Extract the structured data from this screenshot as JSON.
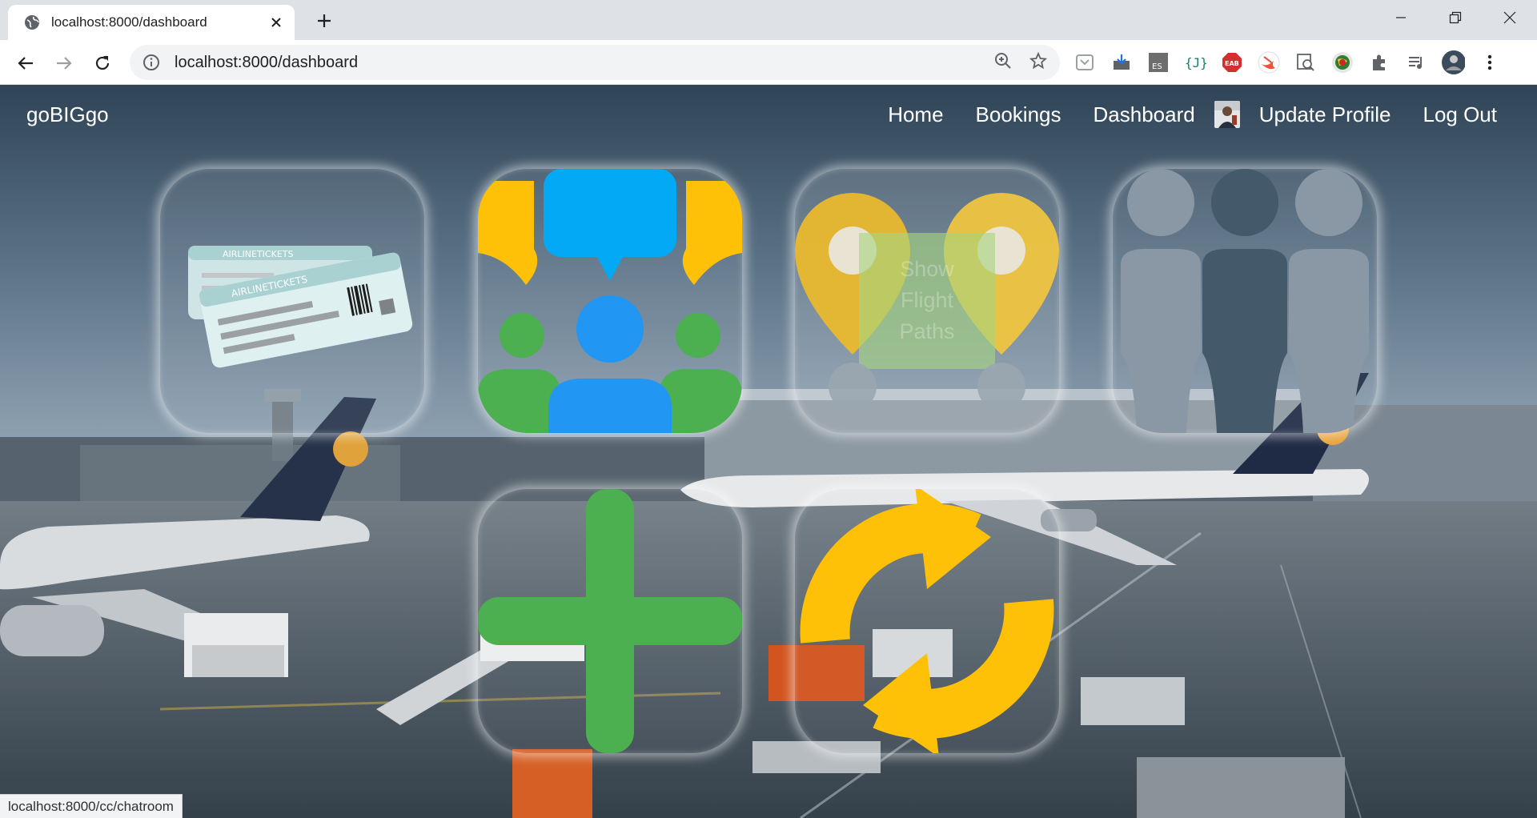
{
  "browser": {
    "tab_title": "localhost:8000/dashboard",
    "url": "localhost:8000/dashboard",
    "status_url": "localhost:8000/cc/chatroom",
    "extensions": [
      "pocket-icon",
      "save-icon",
      "es-icon",
      "json-icon",
      "eab-icon",
      "swift-icon",
      "search-page-icon",
      "globe-ext-icon",
      "puzzle-icon",
      "media-icon"
    ]
  },
  "navbar": {
    "brand": "goBIGgo",
    "links": {
      "home": "Home",
      "bookings": "Bookings",
      "dashboard": "Dashboard",
      "update_profile": "Update Profile",
      "logout": "Log Out"
    }
  },
  "cards": {
    "tickets": {
      "label_1": "AIRLINETICKETS",
      "label_2": "AIRLINETICKETS"
    },
    "flight_paths": {
      "label": "Show Flight Paths"
    }
  },
  "colors": {
    "accent_green": "#4caf50",
    "accent_yellow": "#ffc107",
    "accent_blue": "#2196f3",
    "sky_blue": "#03a9f4"
  }
}
